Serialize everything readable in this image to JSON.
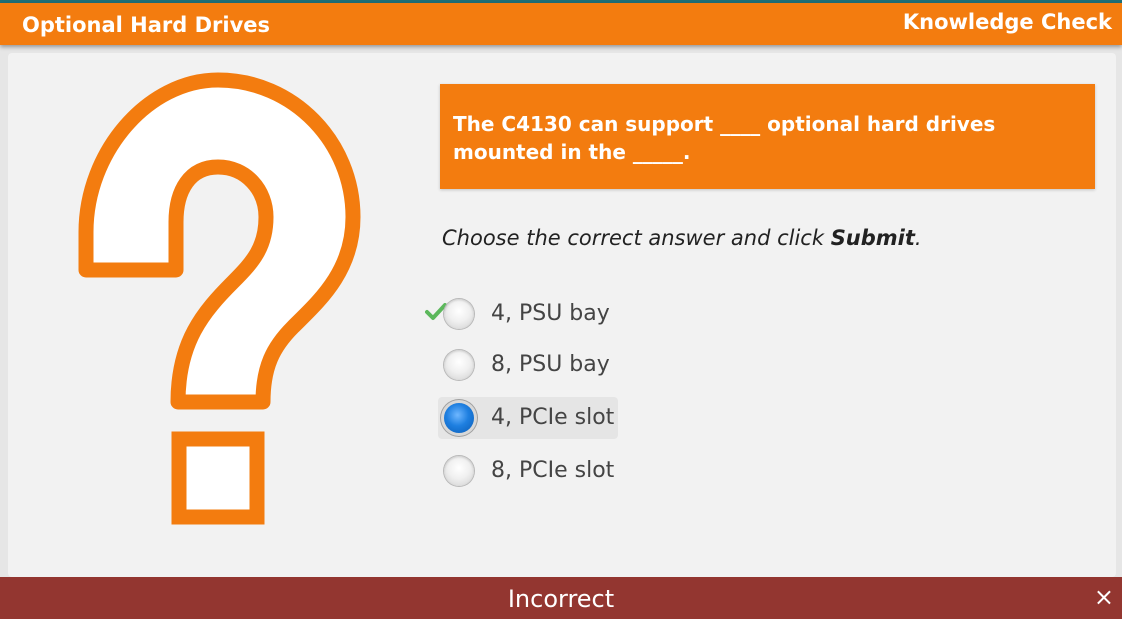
{
  "header": {
    "title": "Optional Hard Drives",
    "right_label": "Knowledge Check"
  },
  "question": {
    "text": "The C4130 can support ____ optional hard drives mounted in the _____."
  },
  "instruction": {
    "before": "Choose the correct answer and click ",
    "bold": "Submit",
    "after": "."
  },
  "options": [
    {
      "label": "4, PSU bay",
      "selected": false,
      "correct": true
    },
    {
      "label": "8, PSU bay",
      "selected": false,
      "correct": false
    },
    {
      "label": "4, PCIe slot",
      "selected": true,
      "correct": false
    },
    {
      "label": "8, PCIe slot",
      "selected": false,
      "correct": false
    }
  ],
  "feedback": {
    "text": "Incorrect",
    "close_symbol": "×"
  },
  "icons": {
    "question_mark": "question-mark-icon",
    "check": "check-icon",
    "close": "close-icon"
  },
  "colors": {
    "accent_orange": "#f37c0f",
    "feedback_red": "#933630",
    "check_green": "#5cb85c",
    "radio_blue": "#1e7fe0"
  }
}
